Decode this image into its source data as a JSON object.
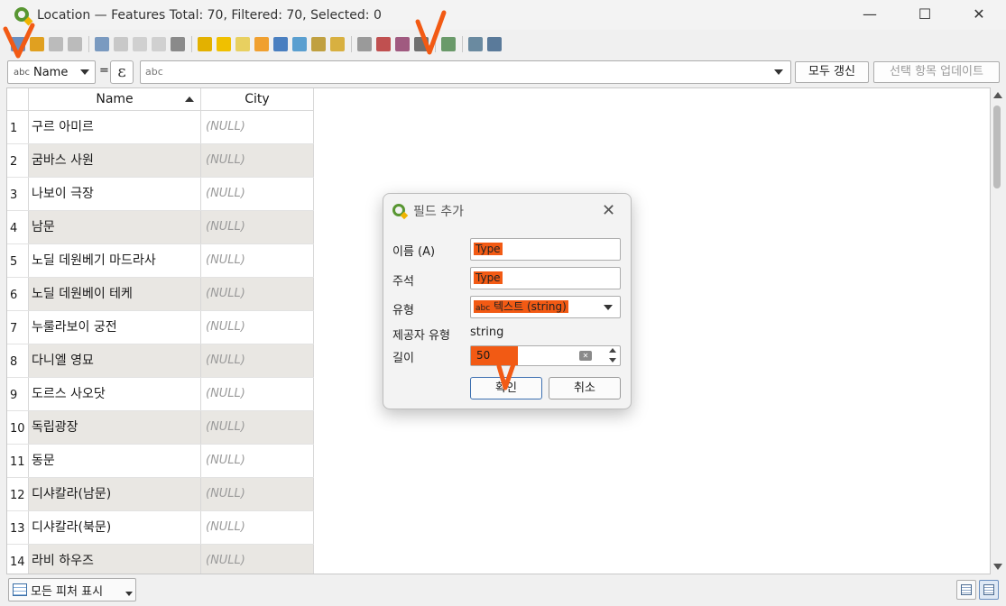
{
  "window": {
    "title": "Location — Features Total: 70, Filtered: 70, Selected: 0",
    "minimize": "—",
    "maximize": "☐",
    "close": "✕"
  },
  "filter": {
    "field_type": "abc",
    "field_name": "Name",
    "equals": "=",
    "expression_symbol": "ε",
    "value_type": "abc",
    "refresh_all": "모두 갱신",
    "update_selected": "선택 항목 업데이트"
  },
  "table": {
    "columns": [
      "Name",
      "City"
    ],
    "rows": [
      {
        "num": "1",
        "name": "구르 아미르",
        "city": "(NULL)"
      },
      {
        "num": "2",
        "name": "굼바스 사원",
        "city": "(NULL)"
      },
      {
        "num": "3",
        "name": "나보이 극장",
        "city": "(NULL)"
      },
      {
        "num": "4",
        "name": "남문",
        "city": "(NULL)"
      },
      {
        "num": "5",
        "name": "노딜 데원베기 마드라사",
        "city": "(NULL)"
      },
      {
        "num": "6",
        "name": "노딜 데원베이 테케",
        "city": "(NULL)"
      },
      {
        "num": "7",
        "name": "누룰라보이 궁전",
        "city": "(NULL)"
      },
      {
        "num": "8",
        "name": "다니엘 영묘",
        "city": "(NULL)"
      },
      {
        "num": "9",
        "name": "도르스 사오닷",
        "city": "(NULL)"
      },
      {
        "num": "10",
        "name": "독립광장",
        "city": "(NULL)"
      },
      {
        "num": "11",
        "name": "동문",
        "city": "(NULL)"
      },
      {
        "num": "12",
        "name": "디샤칼라(남문)",
        "city": "(NULL)"
      },
      {
        "num": "13",
        "name": "디샤칼라(북문)",
        "city": "(NULL)"
      },
      {
        "num": "14",
        "name": "라비 하우즈",
        "city": "(NULL)"
      }
    ]
  },
  "bottom": {
    "show_all": "모든 피처 표시"
  },
  "dialog": {
    "title": "필드 추가",
    "close": "✕",
    "name_label": "이름 (A)",
    "name_value": "Type",
    "comment_label": "주석",
    "comment_value": "Type",
    "type_label": "유형",
    "type_icon": "abc",
    "type_value": "텍스트 (string)",
    "provider_type_label": "제공자 유형",
    "provider_type_value": "string",
    "length_label": "길이",
    "length_value": "50",
    "ok": "확인",
    "cancel": "취소"
  },
  "colors": {
    "qgis_green": "#589632",
    "qgis_yellow": "#f0b400",
    "annotation_orange": "#f25a14",
    "row_alt": "#e9e7e3",
    "null_text": "#9a9a9a"
  }
}
